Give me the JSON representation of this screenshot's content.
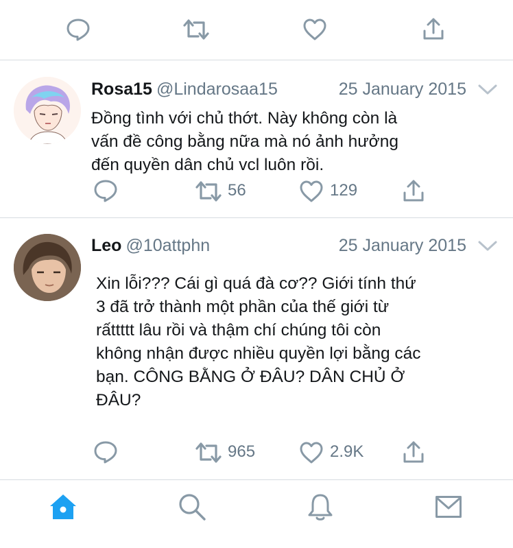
{
  "top_actions": [
    "reply-icon",
    "retweet-icon",
    "like-icon",
    "share-icon"
  ],
  "tweets": [
    {
      "name": "Rosa15",
      "handle": "@Lindarosaa15",
      "date": "25 January 2015",
      "text": "Đồng tình với chủ thớt. Này không còn là\nvấn đề công bằng nữa mà nó ảnh hưởng\nđến quyền dân chủ vcl luôn rồi.",
      "retweets": "56",
      "likes": "129"
    },
    {
      "name": "Leo",
      "handle": "@10attphn",
      "date": "25 January 2015",
      "text": "Xin lỗi??? Cái gì quá đà cơ?? Giới tính thứ\n3 đã trở thành một phần của thế giới từ\nrấttttt lâu rồi và thậm chí chúng tôi còn\nkhông nhận được nhiều quyền lợi bằng các\nbạn. CÔNG BẰNG Ở ĐÂU? DÂN CHỦ Ở\nĐÂU?",
      "retweets": "965",
      "likes": "2.9K"
    }
  ],
  "tabbar": {
    "items": [
      "home-icon",
      "search-icon",
      "notifications-icon",
      "messages-icon"
    ],
    "active": "home-icon",
    "active_color": "#1da1f2",
    "inactive_color": "#8899a6"
  },
  "colors": {
    "icon_gray": "#8899a6",
    "text_gray": "#657786",
    "divider": "#d6dbe0"
  }
}
